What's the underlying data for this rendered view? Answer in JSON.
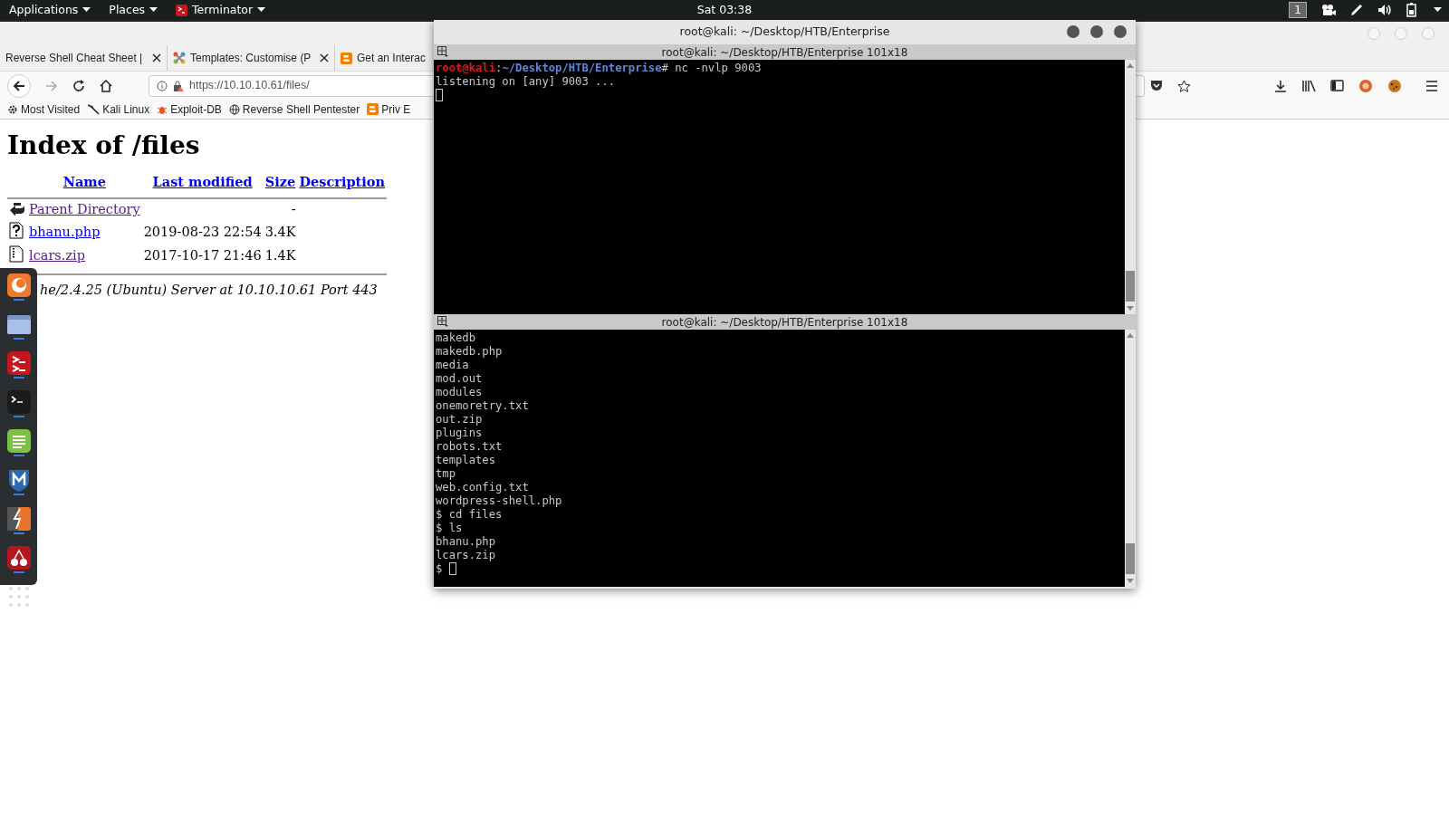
{
  "top_bar": {
    "menus": [
      {
        "label": "Applications",
        "icon": false
      },
      {
        "label": "Places",
        "icon": false
      },
      {
        "label": "Terminator",
        "icon": true
      }
    ],
    "clock": "Sat 03:38",
    "workspace": "1"
  },
  "browser": {
    "tabs": [
      {
        "title": "Reverse Shell Cheat Sheet |",
        "closable": true
      },
      {
        "title": "Templates: Customise (P",
        "closable": true
      },
      {
        "title": "Get an Interac",
        "closable": false
      }
    ],
    "url": "https://10.10.10.61/files/",
    "bookmarks": [
      {
        "label": "Most Visited"
      },
      {
        "label": "Kali Linux"
      },
      {
        "label": "Exploit-DB"
      },
      {
        "label": "Reverse Shell Pentester"
      },
      {
        "label": "Priv E"
      }
    ],
    "page": {
      "heading": "Index of /files",
      "columns": [
        "Name",
        "Last modified",
        "Size",
        "Description"
      ],
      "rows": [
        {
          "kind": "back",
          "name": "Parent Directory",
          "size": "-"
        },
        {
          "kind": "unknown",
          "name": "bhanu.php",
          "modified": "2019-08-23 22:54",
          "size": "3.4K"
        },
        {
          "kind": "compressed",
          "name": "lcars.zip",
          "modified": "2017-10-17 21:46",
          "size": "1.4K"
        }
      ],
      "address": "he/2.4.25 (Ubuntu) Server at 10.10.10.61 Port 443"
    }
  },
  "dock": {
    "apps": [
      {
        "kind": "browser"
      },
      {
        "kind": "files"
      },
      {
        "kind": "terminator"
      },
      {
        "kind": "terminal"
      },
      {
        "kind": "notes"
      },
      {
        "kind": "metasploit"
      },
      {
        "kind": "burp"
      },
      {
        "kind": "cherry"
      },
      {
        "kind": "grid"
      }
    ]
  },
  "terminal": {
    "title": "root@kali: ~/Desktop/HTB/Enterprise",
    "panes": [
      {
        "header": "root@kali: ~/Desktop/HTB/Enterprise 101x18",
        "lines": [
          {
            "kind": "prompt",
            "user": "root@kali",
            "separator": ":",
            "path": "~/Desktop/HTB/Enterprise",
            "command": "# nc -nvlp 9003"
          },
          {
            "kind": "output",
            "text": "listening on [any] 9003 ..."
          },
          {
            "kind": "cursor"
          }
        ]
      },
      {
        "header": "root@kali: ~/Desktop/HTB/Enterprise 101x18",
        "lines": [
          {
            "kind": "output",
            "text": "makedb"
          },
          {
            "kind": "output",
            "text": "makedb.php"
          },
          {
            "kind": "output",
            "text": "media"
          },
          {
            "kind": "output",
            "text": "mod.out"
          },
          {
            "kind": "output",
            "text": "modules"
          },
          {
            "kind": "output",
            "text": "onemoretry.txt"
          },
          {
            "kind": "output",
            "text": "out.zip"
          },
          {
            "kind": "output",
            "text": "plugins"
          },
          {
            "kind": "output",
            "text": "robots.txt"
          },
          {
            "kind": "output",
            "text": "templates"
          },
          {
            "kind": "output",
            "text": "tmp"
          },
          {
            "kind": "output",
            "text": "web.config.txt"
          },
          {
            "kind": "output",
            "text": "wordpress-shell.php"
          },
          {
            "kind": "output",
            "text": "$ cd files"
          },
          {
            "kind": "output",
            "text": "$ ls"
          },
          {
            "kind": "output",
            "text": "bhanu.php"
          },
          {
            "kind": "output",
            "text": "lcars.zip"
          },
          {
            "kind": "input",
            "text": "$"
          }
        ]
      }
    ]
  }
}
